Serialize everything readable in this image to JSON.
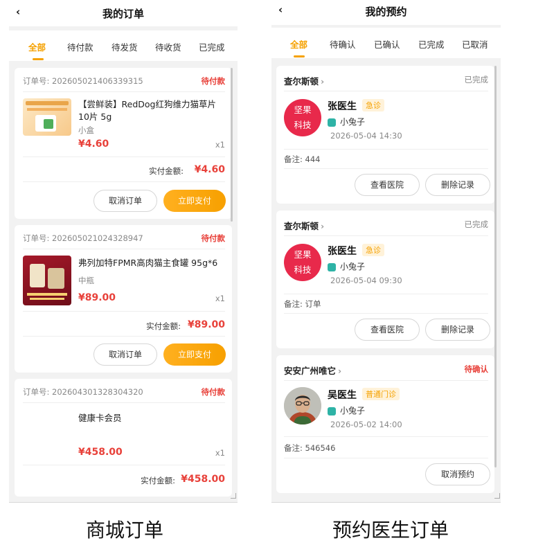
{
  "mall": {
    "title": "我的订单",
    "back_icon": "‹",
    "tabs": [
      "全部",
      "待付款",
      "待发货",
      "待收货",
      "已完成"
    ],
    "active_tab": "全部",
    "orders": [
      {
        "order_no": "订单号: 202605021406339315",
        "status": "待付款",
        "product_name": "【尝鲜装】RedDog红狗维力猫草片10片 5g",
        "spec": "小盒",
        "price": "¥4.60",
        "qty": "x1",
        "paid_label": "实付金额:",
        "paid_amount": "¥4.60",
        "cancel_label": "取消订单",
        "pay_label": "立即支付"
      },
      {
        "order_no": "订单号: 202605021024328947",
        "status": "待付款",
        "product_name": "弗列加特FPMR高肉猫主食罐 95g*6",
        "spec": "中瓶",
        "price": "¥89.00",
        "qty": "x1",
        "paid_label": "实付金额:",
        "paid_amount": "¥89.00",
        "cancel_label": "取消订单",
        "pay_label": "立即支付"
      },
      {
        "order_no": "订单号: 202604301328304320",
        "status": "待付款",
        "product_name": "健康卡会员",
        "spec": "",
        "price": "¥458.00",
        "qty": "x1",
        "paid_label": "实付金额:",
        "paid_amount": "¥458.00"
      }
    ]
  },
  "appointment": {
    "title": "我的预约",
    "back_icon": "‹",
    "tabs": [
      "全部",
      "待确认",
      "已确认",
      "已完成",
      "已取消"
    ],
    "active_tab": "全部",
    "items": [
      {
        "hospital": "查尔斯顿",
        "status": "已完成",
        "avatar_text_1": "坚果",
        "avatar_text_2": "科技",
        "doctor": "张医生",
        "tag": "急诊",
        "pet": "小兔子",
        "time": "2026-05-04 14:30",
        "note": "备注: 444",
        "btn_view": "查看医院",
        "btn_delete": "删除记录"
      },
      {
        "hospital": "查尔斯顿",
        "status": "已完成",
        "avatar_text_1": "坚果",
        "avatar_text_2": "科技",
        "doctor": "张医生",
        "tag": "急诊",
        "pet": "小兔子",
        "time": "2026-05-04 09:30",
        "note": "备注: 订单",
        "btn_view": "查看医院",
        "btn_delete": "删除记录"
      },
      {
        "hospital": "安安广州唯它",
        "status": "待确认",
        "doctor": "吴医生",
        "tag": "普通门诊",
        "pet": "小兔子",
        "time": "2026-05-02 14:00",
        "note": "备注: 546546",
        "btn_cancel": "取消预约"
      }
    ]
  },
  "captions": {
    "left": "商城订单",
    "right": "预约医生订单"
  },
  "colors": {
    "accent": "#f5a100",
    "price_red": "#e8413a",
    "logo_red": "#e8294b"
  }
}
